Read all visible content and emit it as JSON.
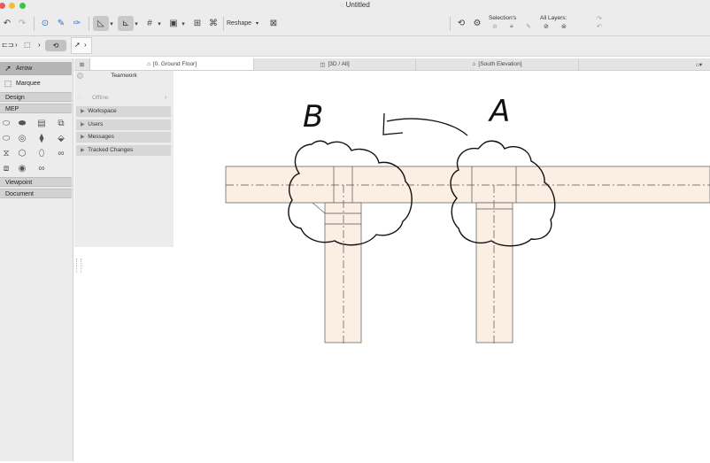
{
  "window": {
    "title": "Untitled"
  },
  "toolbar": {
    "reshape_label": "Reshape",
    "selections_label": "Selection's",
    "all_layers_label": "All Layers:"
  },
  "toolbox": {
    "tools": [
      {
        "label": "Arrow",
        "icon": "arrow-cursor-icon"
      },
      {
        "label": "Marquee",
        "icon": "marquee-icon"
      }
    ],
    "groups": [
      "Design",
      "MEP",
      "Viewpoint",
      "Document"
    ]
  },
  "tabs": [
    {
      "label": "[0. Ground Floor]",
      "icon": "floor-plan-icon"
    },
    {
      "label": "[3D / All]",
      "icon": "3d-view-icon"
    },
    {
      "label": "[South Elevation]",
      "icon": "elevation-icon"
    }
  ],
  "teamwork": {
    "title": "Teamwork",
    "status": "Offline",
    "sections": [
      "Workspace",
      "Users",
      "Messages",
      "Tracked Changes"
    ]
  },
  "sketch_labels": {
    "left": "B",
    "right": "A"
  },
  "colors": {
    "beam_fill": "#fbeee2",
    "chrome": "#ececec",
    "selected_tool": "#b5b5b5"
  }
}
